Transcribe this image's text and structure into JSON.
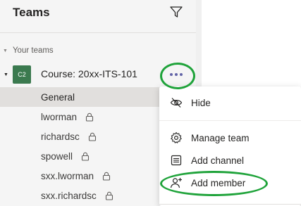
{
  "header": {
    "title": "Teams"
  },
  "section": {
    "label": "Your teams"
  },
  "team": {
    "avatar": "C2",
    "name": "Course: 20xx-ITS-101"
  },
  "channels": [
    {
      "label": "General",
      "locked": false
    },
    {
      "label": "lworman",
      "locked": true
    },
    {
      "label": "richardsc",
      "locked": true
    },
    {
      "label": "spowell",
      "locked": true
    },
    {
      "label": "sxx.lworman",
      "locked": true
    },
    {
      "label": "sxx.richardsc",
      "locked": true
    }
  ],
  "menu": {
    "items": [
      {
        "label": "Hide",
        "icon": "hide-icon"
      },
      {
        "label": "Manage team",
        "icon": "gear-icon"
      },
      {
        "label": "Add channel",
        "icon": "add-channel-icon"
      },
      {
        "label": "Add member",
        "icon": "add-member-icon"
      }
    ]
  },
  "colors": {
    "accent": "#6264a7",
    "avatar": "#3b7a4f",
    "highlight": "#1fa33a",
    "selected": "#e1dfdd"
  }
}
